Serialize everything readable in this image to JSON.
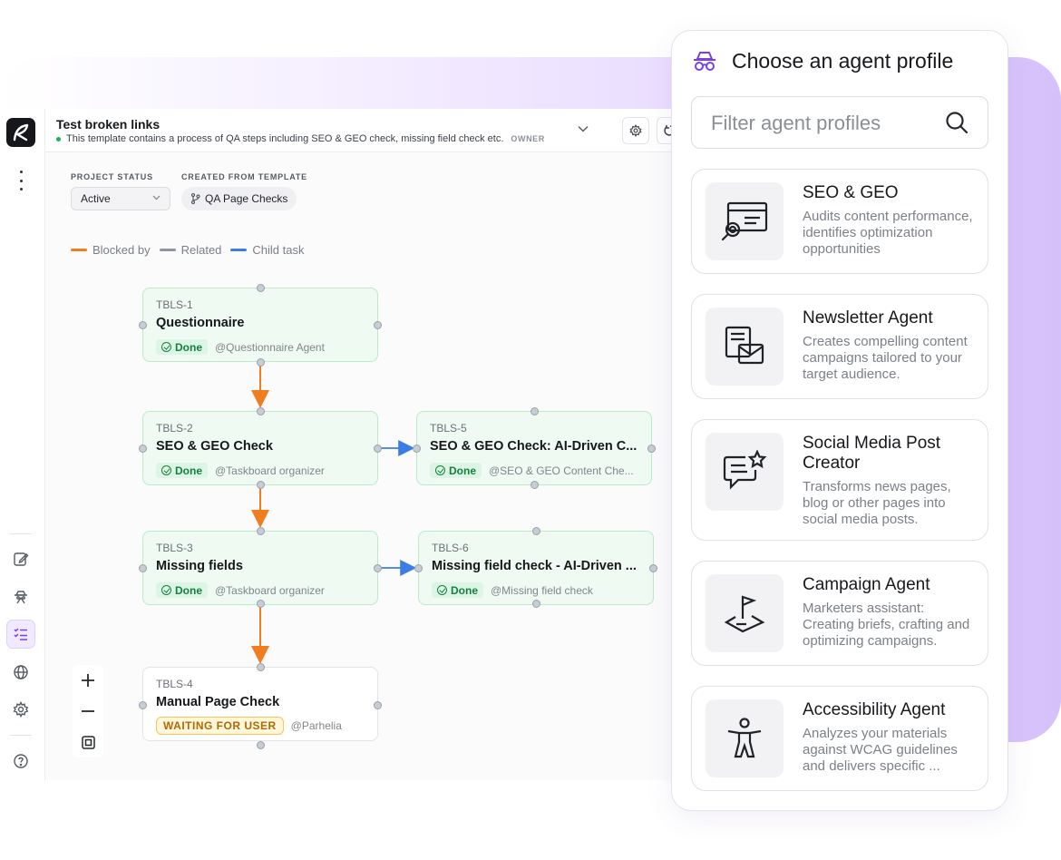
{
  "project": {
    "title": "Test broken links",
    "description": "This template contains a process of QA steps including SEO & GEO check, missing field check etc.",
    "role": "OWNER"
  },
  "meta": {
    "status_label": "PROJECT STATUS",
    "status_value": "Active",
    "template_label": "CREATED FROM TEMPLATE",
    "template_value": "QA Page Checks"
  },
  "legend": [
    {
      "label": "Blocked by",
      "color": "#f07d20"
    },
    {
      "label": "Related",
      "color": "#8a96a3"
    },
    {
      "label": "Child task",
      "color": "#3b7de8"
    }
  ],
  "tasks": [
    {
      "id": "TBLS-1",
      "title": "Questionnaire",
      "status": "Done",
      "assignee": "@Questionnaire Agent"
    },
    {
      "id": "TBLS-2",
      "title": "SEO & GEO Check",
      "status": "Done",
      "assignee": "@Taskboard organizer"
    },
    {
      "id": "TBLS-5",
      "title": "SEO & GEO Check: AI-Driven C...",
      "status": "Done",
      "assignee": "@SEO & GEO Content Che..."
    },
    {
      "id": "TBLS-3",
      "title": "Missing fields",
      "status": "Done",
      "assignee": "@Taskboard organizer"
    },
    {
      "id": "TBLS-6",
      "title": "Missing field check - AI-Driven ...",
      "status": "Done",
      "assignee": "@Missing field check"
    },
    {
      "id": "TBLS-4",
      "title": "Manual Page Check",
      "status": "WAITING FOR USER",
      "assignee": "@Parhelia"
    }
  ],
  "colors": {
    "blocked": "#f07d20",
    "child": "#3b7de8",
    "done_bg": "#eefaf2",
    "accent": "#7b3fe4"
  },
  "agent_panel": {
    "title": "Choose an agent profile",
    "search_placeholder": "Filter agent profiles",
    "agents": [
      {
        "name": "SEO & GEO",
        "description": "Audits content performance, identifies optimization opportunities",
        "icon": "seo-document-magnifier-icon"
      },
      {
        "name": "Newsletter Agent",
        "description": "Creates compelling content campaigns tailored to your target audience.",
        "icon": "newsletter-envelope-icon"
      },
      {
        "name": "Social Media Post Creator",
        "description": "Transforms news pages, blog or other pages into social media posts.",
        "icon": "chat-star-icon"
      },
      {
        "name": "Campaign Agent",
        "description": "Marketers assistant: Creating briefs, crafting and optimizing campaigns.",
        "icon": "flag-map-icon"
      },
      {
        "name": "Accessibility Agent",
        "description": "Analyzes your materials against WCAG guidelines and delivers specific ...",
        "icon": "accessibility-person-icon"
      }
    ]
  }
}
